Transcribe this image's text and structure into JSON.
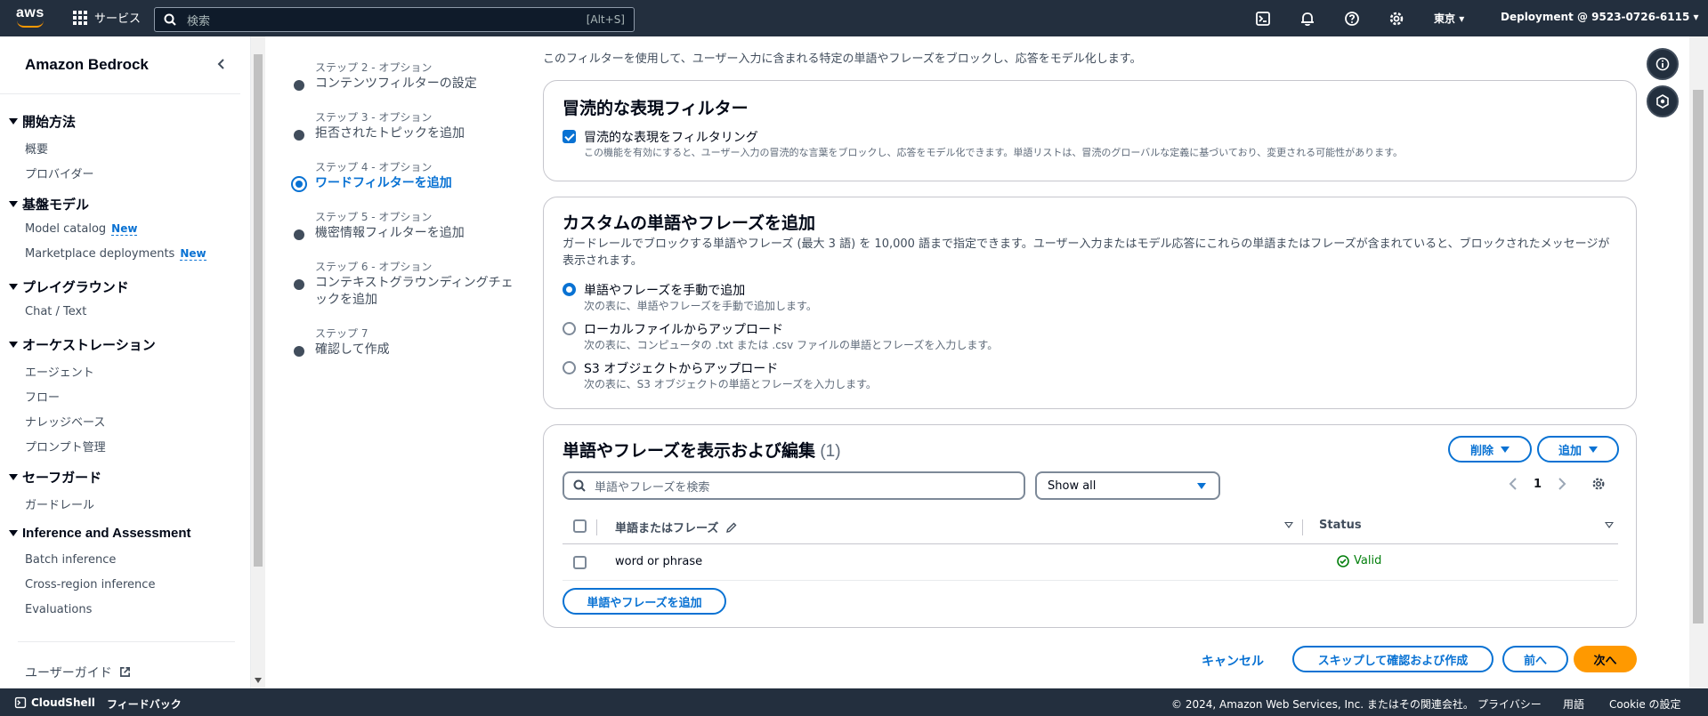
{
  "topnav": {
    "logo": "aws",
    "services_label": "サービス",
    "search_placeholder": "検索",
    "search_shortcut": "[Alt+S]",
    "region": "東京",
    "account": "Deployment @ 9523-0726-6115"
  },
  "sidebar": {
    "title": "Amazon Bedrock",
    "sections": [
      {
        "label": "開始方法",
        "items": [
          "概要",
          "プロバイダー"
        ]
      },
      {
        "label": "基盤モデル",
        "items": [
          "Model catalog",
          "Marketplace deployments"
        ]
      },
      {
        "label": "プレイグラウンド",
        "items": [
          "Chat / Text"
        ]
      },
      {
        "label": "オーケストレーション",
        "items": [
          "エージェント",
          "フロー",
          "ナレッジベース",
          "プロンプト管理"
        ]
      },
      {
        "label": "セーフガード",
        "items": [
          "ガードレール"
        ]
      },
      {
        "label": "Inference and Assessment",
        "items": [
          "Batch inference",
          "Cross-region inference",
          "Evaluations"
        ]
      }
    ],
    "new_badge": "New",
    "user_guide": "ユーザーガイド"
  },
  "steps": [
    {
      "label": "ステップ 2 - オプション",
      "name": "コンテンツフィルターの設定"
    },
    {
      "label": "ステップ 3 - オプション",
      "name": "拒否されたトピックを追加"
    },
    {
      "label": "ステップ 4 - オプション",
      "name": "ワードフィルターを追加"
    },
    {
      "label": "ステップ 5 - オプション",
      "name": "機密情報フィルターを追加"
    },
    {
      "label": "ステップ 6 - オプション",
      "name": "コンテキストグラウンディングチェックを追加"
    },
    {
      "label": "ステップ 7",
      "name": "確認して作成"
    }
  ],
  "intro": "このフィルターを使用して、ユーザー入力に含まれる特定の単語やフレーズをブロックし、応答をモデル化します。",
  "profanity": {
    "title": "冒涜的な表現フィルター",
    "checkbox_label": "冒涜的な表現をフィルタリング",
    "checkbox_desc": "この機能を有効にすると、ユーザー入力の冒涜的な言葉をブロックし、応答をモデル化できます。単語リストは、冒涜のグローバルな定義に基づいており、変更される可能性があります。",
    "checked": true
  },
  "custom": {
    "title": "カスタムの単語やフレーズを追加",
    "desc": "ガードレールでブロックする単語やフレーズ (最大 3 語) を 10,000 語まで指定できます。ユーザー入力またはモデル応答にこれらの単語またはフレーズが含まれていると、ブロックされたメッセージが表示されます。",
    "options": [
      {
        "label": "単語やフレーズを手動で追加",
        "sub": "次の表に、単語やフレーズを手動で追加します。",
        "checked": true
      },
      {
        "label": "ローカルファイルからアップロード",
        "sub": "次の表に、コンピュータの .txt または .csv ファイルの単語とフレーズを入力します。",
        "checked": false
      },
      {
        "label": "S3 オブジェクトからアップロード",
        "sub": "次の表に、S3 オブジェクトの単語とフレーズを入力します。",
        "checked": false
      }
    ]
  },
  "table": {
    "title": "単語やフレーズを表示および編集",
    "count": "(1)",
    "delete_label": "削除",
    "add_label": "追加",
    "search_placeholder": "単語やフレーズを検索",
    "filter_value": "Show all",
    "page": "1",
    "col_word": "単語またはフレーズ",
    "col_status": "Status",
    "rows": [
      {
        "word": "word or phrase",
        "status": "Valid"
      }
    ],
    "add_button": "単語やフレーズを追加"
  },
  "actions": {
    "cancel": "キャンセル",
    "skip": "スキップして確認および作成",
    "prev": "前へ",
    "next": "次へ"
  },
  "bottombar": {
    "cloudshell": "CloudShell",
    "feedback": "フィードバック",
    "copyright": "© 2024, Amazon Web Services, Inc. またはその関連会社。",
    "privacy": "プライバシー",
    "terms": "用語",
    "cookies": "Cookie の設定"
  },
  "colors": {
    "accent": "#0972d3",
    "primary_button": "#ff9900",
    "nav_bg": "#232f3e",
    "valid": "#037f0c"
  }
}
